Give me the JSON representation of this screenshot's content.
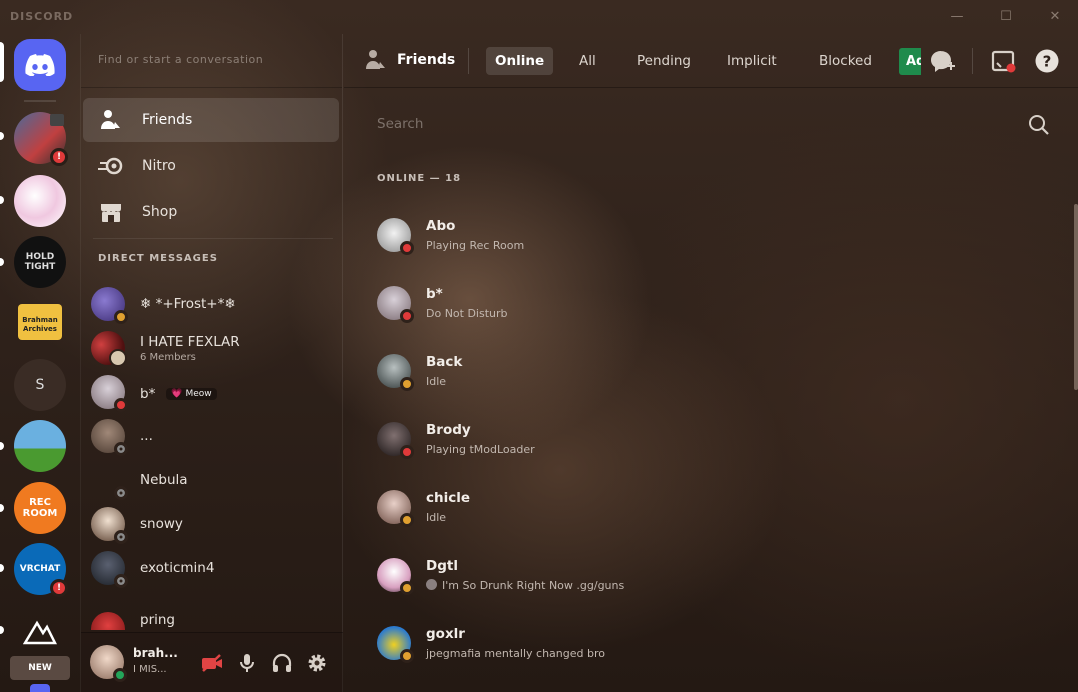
{
  "app": {
    "logo": "DISCORD"
  },
  "window": {
    "minimize": "—",
    "maximize": "☐",
    "close": "✕"
  },
  "servers": [
    {
      "name": "discord-home",
      "badge": ""
    },
    {
      "name": "server-1",
      "badge": "!"
    },
    {
      "name": "server-2",
      "badge": ""
    },
    {
      "name": "server-hold-tight",
      "text": "HOLD TIGHT",
      "badge": ""
    },
    {
      "name": "server-brahman-archives",
      "text": "Brahman Archives",
      "badge": ""
    },
    {
      "name": "server-s",
      "text": "S",
      "badge": ""
    },
    {
      "name": "server-game",
      "badge": ""
    },
    {
      "name": "server-rec-room",
      "text": "REC ROOM",
      "badge": ""
    },
    {
      "name": "server-vrchat",
      "text": "VRCHAT",
      "badge": "!"
    },
    {
      "name": "server-mountain",
      "badge": ""
    }
  ],
  "rail_new_label": "NEW",
  "dmpane": {
    "search_placeholder": "Find or start a conversation",
    "nav": [
      {
        "label": "Friends"
      },
      {
        "label": "Nitro"
      },
      {
        "label": "Shop"
      }
    ],
    "section_header": "DIRECT MESSAGES",
    "dms": [
      {
        "name": "❄ *+Frost+*❄",
        "sub": "",
        "status": "idle",
        "color": "#5b4aa0"
      },
      {
        "name": "I HATE FEXLAR",
        "sub": "6 Members",
        "status": "",
        "color": "#8a2a2a"
      },
      {
        "name": "b*",
        "sub": "",
        "tag": "💗 Meow",
        "status": "dnd",
        "color": "#9a8e90"
      },
      {
        "name": "...",
        "sub": "",
        "status": "off",
        "color": "#6a5a50"
      },
      {
        "name": "Nebula",
        "sub": "",
        "status": "off",
        "color": "transparent"
      },
      {
        "name": "snowy",
        "sub": "",
        "status": "off",
        "color": "#c29a70"
      },
      {
        "name": "exoticmin4",
        "sub": "",
        "status": "off",
        "color": "#2a3038"
      },
      {
        "name": "pring",
        "sub": "",
        "status": "",
        "color": "#b03030"
      }
    ],
    "user": {
      "name": "brah...",
      "status_text": "I MIS...",
      "status": "on"
    }
  },
  "main": {
    "title": "Friends",
    "tabs": [
      "Online",
      "All",
      "Pending",
      "Implicit",
      "Blocked"
    ],
    "add_friend_label": "Add Friend",
    "search_placeholder": "Search",
    "online_header": "ONLINE — 18",
    "friends": [
      {
        "name": "Abo",
        "activity": "Playing Rec Room",
        "status": "dnd",
        "color": "#d8d8d8"
      },
      {
        "name": "b*",
        "activity": "Do Not Disturb",
        "status": "dnd",
        "color": "#9a8e90"
      },
      {
        "name": "Back",
        "activity": "Idle",
        "status": "idle",
        "color": "#707878"
      },
      {
        "name": "Brody",
        "activity": "Playing tModLoader",
        "status": "dnd",
        "color": "#3a3030"
      },
      {
        "name": "chicle",
        "activity": "Idle",
        "status": "idle",
        "color": "#c9a89a"
      },
      {
        "name": "Dgtl",
        "activity": "I'm So Drunk Right Now .gg/guns",
        "status": "idle",
        "color": "#e8d8e0"
      },
      {
        "name": "goxlr",
        "activity": "jpegmafia mentally changed bro",
        "status": "idle",
        "color": "#3a8ad8"
      }
    ]
  }
}
